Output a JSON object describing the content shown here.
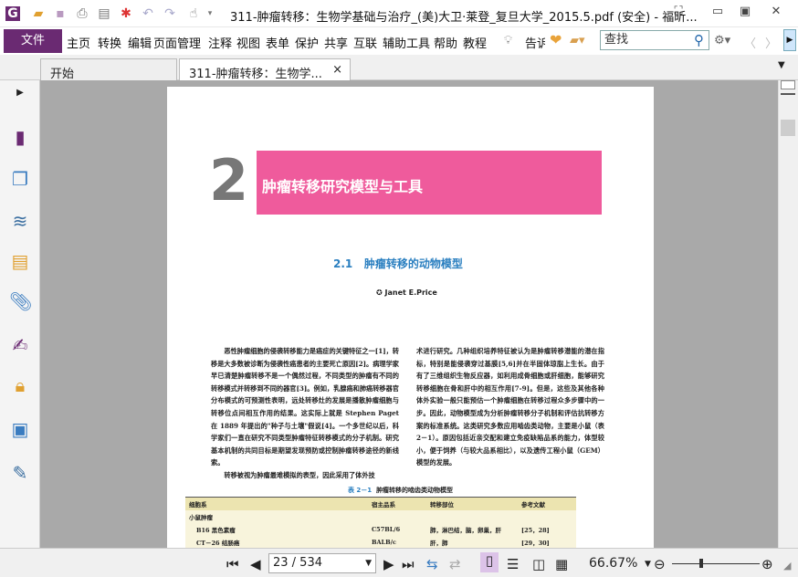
{
  "window": {
    "title": "311-肿瘤转移：生物学基础与治疗_(美)大卫·莱登_复旦大学_2015.5.pdf (安全) - 福昕...",
    "app_icon": "foxit-logo"
  },
  "quick_access": [
    "open-folder-icon",
    "save-icon",
    "print-icon",
    "properties-icon",
    "new-icon",
    "undo-icon",
    "redo-icon",
    "hand-tool-icon"
  ],
  "menubar": {
    "file": "文件",
    "items": [
      "主页",
      "转换",
      "编辑",
      "页面管理",
      "注释",
      "视图",
      "表单",
      "保护",
      "共享",
      "互联",
      "辅助工具",
      "帮助",
      "教程"
    ],
    "tell_me": "告诉",
    "search_placeholder": "查找"
  },
  "tabs": [
    {
      "label": "开始",
      "active": false
    },
    {
      "label": "311-肿瘤转移：生物学...",
      "active": true,
      "close": "×"
    }
  ],
  "document": {
    "chapter_number": "2",
    "chapter_title": "肿瘤转移研究模型与工具",
    "section_number": "2.1",
    "section_title": "肿瘤转移的动物模型",
    "author": "Janet E.Price",
    "left_column": "　　恶性肿瘤细胞的侵袭转移能力是癌症的关键特征之一[1]，转移是大多数被诊断为侵袭性癌患者的主要死亡原因[2]。病理学家早已清楚肿瘤转移不是一个偶然过程，不同类型的肿瘤有不同的转移模式并转移到不同的器官[3]。例如，乳腺癌和肺癌转移器官分布模式的可预测性表明，远处转移灶的发展是播散肿瘤细胞与转移位点间相互作用的结果。这实际上就是 Stephen Paget 在 1889 年提出的\"种子与土壤\"假说[4]。一个多世纪以后，科学家们一直在研究不同类型肿瘤特征转移模式的分子机制。研究基本机制的共同目标是期望发现预防或控制肿瘤转移途径的新线索。\n　　转移被视为肿瘤最难模拟的表型，因此采用了体外技",
    "right_column": "术进行研究。几种组织培养特征被认为是肿瘤转移潜能的潜在指标，特别是能侵袭穿过基膜[5,6]并在半固体琼脂上生长。由于有了三维组织生物反应器，如利用成骨细胞或肝细胞，能够研究转移细胞在骨和肝中的相互作用[7-9]。但是，这些及其他各种体外实验一般只能预估一个肿瘤细胞在转移过程众多步骤中的一步。因此，动物模型成为分析肿瘤转移分子机制和评估抗转移方案的标准系统。这类研究多数应用啮齿类动物，主要是小鼠（表 2－1）。原因包括近亲交配和建立免疫缺陷品系的能力，体型较小，便于饲养（与较大品系相比），以及遗传工程小鼠（GEM）模型的发展。",
    "table_caption_num": "表 2－1",
    "table_caption": "肿瘤转移的啮齿类动物模型",
    "table_headers": [
      "细胞系",
      "宿主品系",
      "转移部位",
      "参考文献"
    ],
    "table_group": "小鼠肿瘤",
    "table_rows": [
      [
        "B16 黑色素瘤",
        "C57BL/6",
        "肺，淋巴结，脑，卵巢，肝",
        "[25，28]"
      ],
      [
        "CT－26 结肠癌",
        "BALB/c",
        "肝，肺",
        "[29，30]"
      ]
    ]
  },
  "statusbar": {
    "page_input": "23 / 534",
    "zoom": "66.67%"
  },
  "colors": {
    "accent": "#6a2a72",
    "banner": "#ef5b9c",
    "heading": "#2a7fc0",
    "table_header": "#ece4b0",
    "table_body": "#f8f4dc"
  }
}
